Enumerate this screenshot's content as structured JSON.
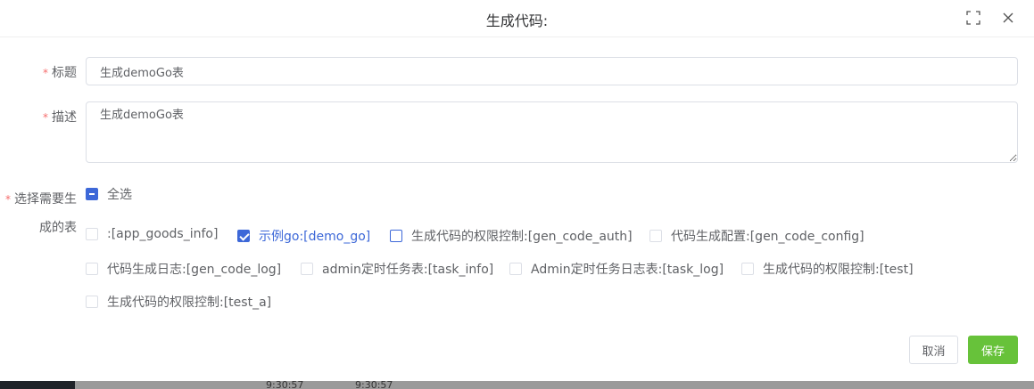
{
  "dialog": {
    "title": "生成代码:",
    "fullscreen_icon": "fullscreen-icon",
    "close_icon": "close-icon"
  },
  "form": {
    "required_mark": "*",
    "title_label": "标题",
    "title_value": "生成demoGo表",
    "desc_label": "描述",
    "desc_value": "生成demoGo表",
    "tables_label_line1": "选择需要生",
    "tables_label_line2": "成的表",
    "select_all": "全选",
    "tables": [
      {
        "label": ":[app_goods_info]",
        "checked": false
      },
      {
        "label": "示例go:[demo_go]",
        "checked": true
      },
      {
        "label": "生成代码的权限控制:[gen_code_auth]",
        "checked": false
      },
      {
        "label": "代码生成配置:[gen_code_config]",
        "checked": false
      },
      {
        "label": "代码生成日志:[gen_code_log]",
        "checked": false
      },
      {
        "label": "admin定时任务表:[task_info]",
        "checked": false
      },
      {
        "label": "Admin定时任务日志表:[task_log]",
        "checked": false
      },
      {
        "label": "生成代码的权限控制:[test]",
        "checked": false
      },
      {
        "label": "生成代码的权限控制:[test_a]",
        "checked": false
      }
    ]
  },
  "footer": {
    "cancel_label": "取消",
    "save_label": "保存"
  },
  "background": {
    "time_1": "9:30:57",
    "time_2": "9:30:57"
  },
  "colors": {
    "accent": "#3d68d8",
    "save_green": "#67c23a",
    "required_red": "#f56c6c"
  }
}
